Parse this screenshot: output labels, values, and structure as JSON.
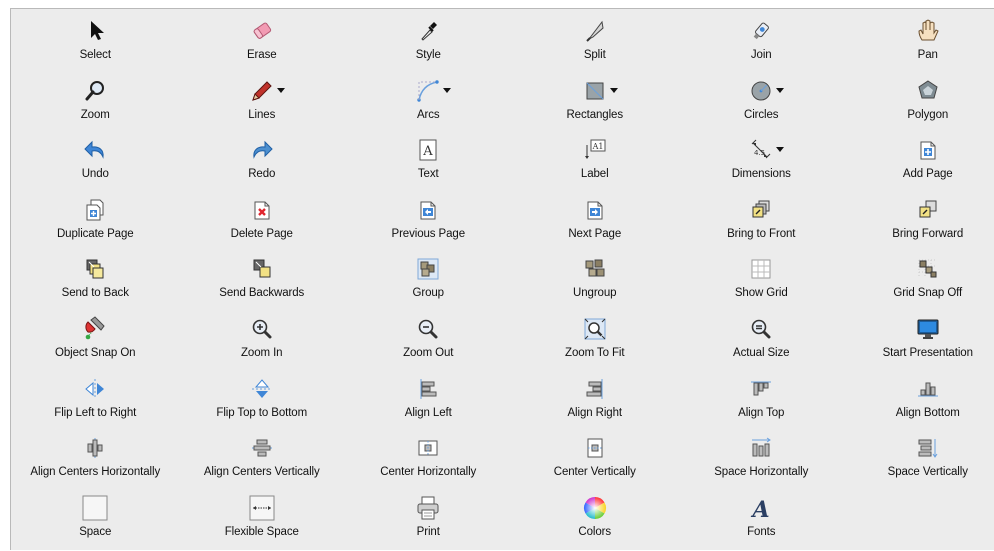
{
  "toolbar_palette": {
    "items": [
      {
        "label": "Select",
        "icon": "arrow-pointer-icon"
      },
      {
        "label": "Erase",
        "icon": "eraser-icon"
      },
      {
        "label": "Style",
        "icon": "eyedropper-icon"
      },
      {
        "label": "Split",
        "icon": "knife-icon"
      },
      {
        "label": "Join",
        "icon": "glue-icon"
      },
      {
        "label": "Pan",
        "icon": "hand-icon"
      },
      {
        "label": "Zoom",
        "icon": "magnifier-icon"
      },
      {
        "label": "Lines",
        "icon": "pencil-icon",
        "dropdown": true
      },
      {
        "label": "Arcs",
        "icon": "arc-icon",
        "dropdown": true
      },
      {
        "label": "Rectangles",
        "icon": "rectangle-icon",
        "dropdown": true
      },
      {
        "label": "Circles",
        "icon": "circle-icon",
        "dropdown": true
      },
      {
        "label": "Polygon",
        "icon": "polygon-icon"
      },
      {
        "label": "Undo",
        "icon": "undo-arrow-icon"
      },
      {
        "label": "Redo",
        "icon": "redo-arrow-icon"
      },
      {
        "label": "Text",
        "icon": "text-box-icon",
        "glyph": "A"
      },
      {
        "label": "Label",
        "icon": "label-icon",
        "glyph": "A1"
      },
      {
        "label": "Dimensions",
        "icon": "dimension-icon",
        "dropdown": true
      },
      {
        "label": "Add Page",
        "icon": "add-page-icon"
      },
      {
        "label": "Duplicate Page",
        "icon": "duplicate-page-icon"
      },
      {
        "label": "Delete Page",
        "icon": "delete-page-icon"
      },
      {
        "label": "Previous Page",
        "icon": "previous-page-icon"
      },
      {
        "label": "Next Page",
        "icon": "next-page-icon"
      },
      {
        "label": "Bring to Front",
        "icon": "bring-to-front-icon"
      },
      {
        "label": "Bring Forward",
        "icon": "bring-forward-icon"
      },
      {
        "label": "Send to Back",
        "icon": "send-to-back-icon"
      },
      {
        "label": "Send Backwards",
        "icon": "send-backwards-icon"
      },
      {
        "label": "Group",
        "icon": "group-icon"
      },
      {
        "label": "Ungroup",
        "icon": "ungroup-icon"
      },
      {
        "label": "Show Grid",
        "icon": "grid-icon"
      },
      {
        "label": "Grid Snap Off",
        "icon": "grid-snap-icon"
      },
      {
        "label": "Object Snap On",
        "icon": "magnet-icon"
      },
      {
        "label": "Zoom In",
        "icon": "zoom-in-icon"
      },
      {
        "label": "Zoom Out",
        "icon": "zoom-out-icon"
      },
      {
        "label": "Zoom To Fit",
        "icon": "zoom-to-fit-icon"
      },
      {
        "label": "Actual Size",
        "icon": "actual-size-icon"
      },
      {
        "label": "Start Presentation",
        "icon": "monitor-icon"
      },
      {
        "label": "Flip Left to Right",
        "icon": "flip-horizontal-icon"
      },
      {
        "label": "Flip Top to Bottom",
        "icon": "flip-vertical-icon"
      },
      {
        "label": "Align Left",
        "icon": "align-left-icon"
      },
      {
        "label": "Align Right",
        "icon": "align-right-icon"
      },
      {
        "label": "Align Top",
        "icon": "align-top-icon"
      },
      {
        "label": "Align Bottom",
        "icon": "align-bottom-icon"
      },
      {
        "label": "Align Centers Horizontally",
        "icon": "align-centers-horizontal-icon"
      },
      {
        "label": "Align Centers Vertically",
        "icon": "align-centers-vertical-icon"
      },
      {
        "label": "Center Horizontally",
        "icon": "center-horizontal-icon"
      },
      {
        "label": "Center Vertically",
        "icon": "center-vertical-icon"
      },
      {
        "label": "Space Horizontally",
        "icon": "space-horizontal-icon"
      },
      {
        "label": "Space Vertically",
        "icon": "space-vertical-icon"
      },
      {
        "label": "Space",
        "icon": "space-box-icon"
      },
      {
        "label": "Flexible Space",
        "icon": "flexible-space-icon"
      },
      {
        "label": "Print",
        "icon": "printer-icon"
      },
      {
        "label": "Colors",
        "icon": "color-wheel-icon"
      },
      {
        "label": "Fonts",
        "icon": "fonts-icon",
        "glyph": "A"
      }
    ]
  },
  "colors": {
    "background": "#ececec",
    "accent_blue": "#3f86d6",
    "delete_red": "#e0252e",
    "eraser_pink": "#f29bb3"
  }
}
